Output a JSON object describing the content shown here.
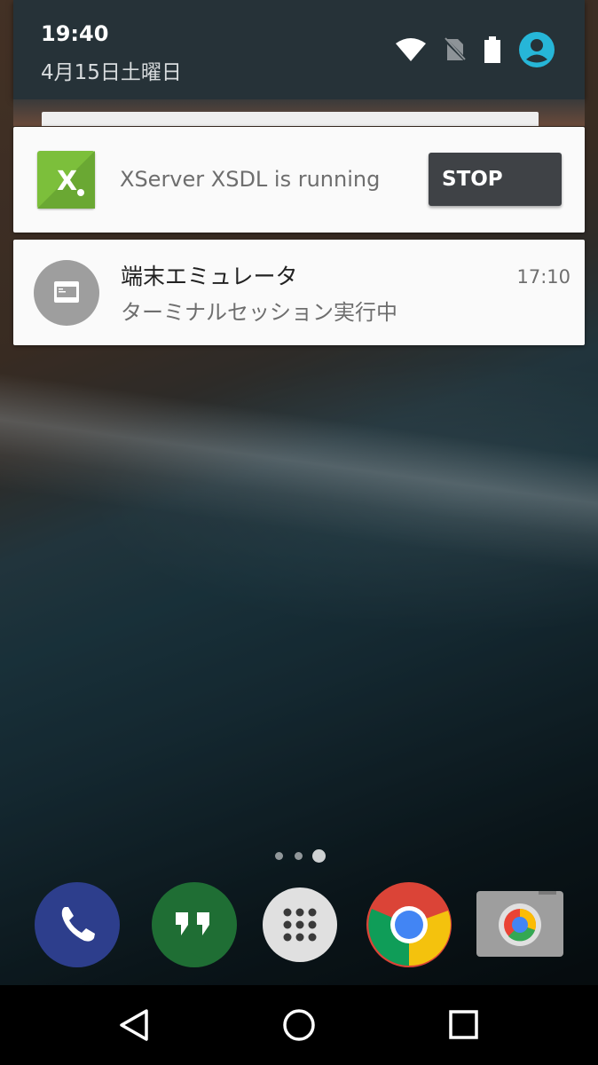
{
  "status": {
    "time": "19:40",
    "date": "4月15日土曜日"
  },
  "notifications": [
    {
      "app_text": "XServer XSDL is running",
      "icon_letter": "X",
      "action_label": "STOP",
      "icon_color": "#7cbf3b"
    },
    {
      "title": "端末エミュレータ",
      "time": "17:10",
      "text": "ターミナルセッション実行中",
      "icon_color": "#9e9e9e"
    }
  ],
  "home": {
    "page_dots_count": 3,
    "active_page": 3,
    "dock": [
      "phone-icon",
      "hangouts-icon",
      "app-drawer-icon",
      "chrome-icon",
      "camera-icon"
    ]
  },
  "navbar": [
    "back-icon",
    "home-icon",
    "recents-icon"
  ],
  "colors": {
    "header_bg": "#263238",
    "card_bg": "#fafafa",
    "stop_button": "#3f4246",
    "account_blue": "#26b6d8"
  }
}
